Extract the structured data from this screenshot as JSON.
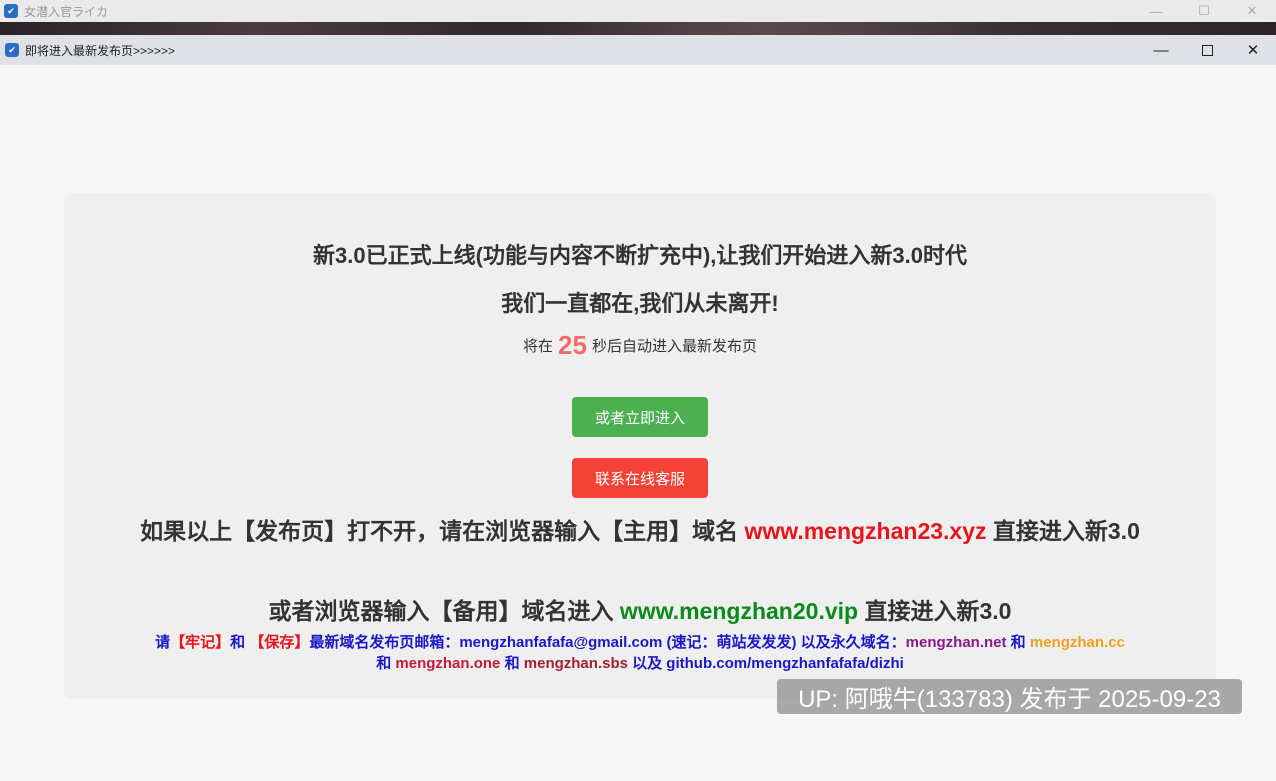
{
  "outer_window": {
    "title": "女潜入官ライカ",
    "controls": {
      "minimize": "—",
      "maximize": "☐",
      "close": "✕"
    }
  },
  "main_window": {
    "title": "即将进入最新发布页>>>>>>",
    "controls": {
      "minimize": "—",
      "close": "✕"
    }
  },
  "content": {
    "headline1": "新3.0已正式上线(功能与内容不断扩充中),让我们开始进入新3.0时代",
    "headline2": "我们一直都在,我们从未离开!",
    "countdown": {
      "prefix": "将在",
      "seconds": "25",
      "suffix": "秒后自动进入最新发布页"
    },
    "buttons": {
      "enter_now": "或者立即进入",
      "customer_service": "联系在线客服"
    },
    "main_domain": {
      "prefix": "如果以上【发布页】打不开，请在浏览器输入【主用】域名",
      "domain": "www.mengzhan23.xyz",
      "suffix": "直接进入新3.0"
    },
    "backup_domain": {
      "prefix": "或者浏览器输入【备用】域名进入",
      "domain": "www.mengzhan20.vip",
      "suffix": "直接进入新3.0"
    },
    "info": {
      "p1": "请",
      "remember": "【牢记】",
      "p2": "和",
      "save": "【保存】",
      "p3": "最新域名发布页邮箱：mengzhanfafafa@gmail.com (速记：萌站发发发) 以及永久域名：",
      "domain_net": "mengzhan.net",
      "and1": "和",
      "domain_cc": "mengzhan.cc",
      "and2": "和",
      "domain_one": "mengzhan.one",
      "and3": "和",
      "domain_sbs": "mengzhan.sbs",
      "p4": "以及 github.com/mengzhanfafafa/dizhi"
    }
  },
  "overlay": {
    "up_badge": "UP: 阿哦牛(133783) 发布于 2025-09-23"
  },
  "colors": {
    "enter_button": "#4caf50",
    "service_button": "#f44336",
    "countdown_number": "#f06a6a",
    "main_domain": "#e8141c",
    "backup_domain": "#0a8a1a",
    "info_text": "#1a17c9"
  }
}
